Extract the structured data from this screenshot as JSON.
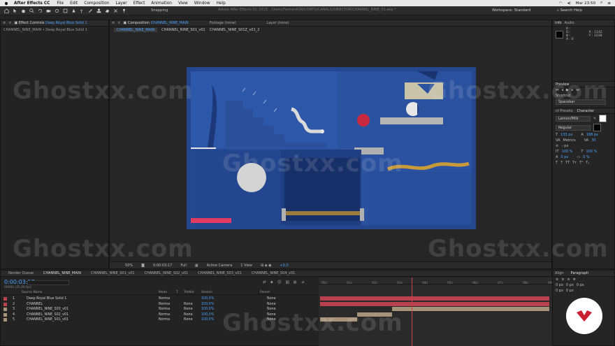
{
  "menubar": {
    "app_name": "After Effects CC",
    "items": [
      "File",
      "Edit",
      "Composition",
      "Layer",
      "Effect",
      "Animation",
      "View",
      "Window",
      "Help"
    ],
    "clock": "Mar 23:50"
  },
  "toolbar": {
    "snapping_label": "Snapping",
    "window_title": "Adobe After Effects CC 2015 - /Users/FermentOR/CONTO/CANALS/DIRECTOR/CHANNEL_NINE_01.aep *",
    "workspace_label": "Workspace:",
    "workspace_value": "Standard",
    "search_label": "Search Help"
  },
  "effect_panel": {
    "tab_prefix": "Effect Controls",
    "tab_layer": "Deep Royal Blue Solid 1",
    "breadcrumb": "CHANNEL_NINE_MAIN • Deep Royal Blue Solid 1"
  },
  "comp_panel": {
    "tab_prefix": "Composition",
    "tab_comp": "CHANNEL_NINE_MAIN",
    "footage_tab": "Footage (none)",
    "layer_tab": "Layer (none)",
    "subtabs": [
      "CHANNEL_NINE_MAIN",
      "CHANNEL_NINE_S01_v01",
      "CHANNEL_NINE_S01Z_v01_2"
    ],
    "footer": {
      "zoom": "50%",
      "timecode": "0:00:03:17",
      "resolution": "Full",
      "camera": "Active Camera",
      "view": "1 View",
      "exposure": "+0,0"
    }
  },
  "right_panel": {
    "info_tabs": [
      "Info",
      "Audio"
    ],
    "x_label": "X : 1142",
    "y_label": "Y : 1238",
    "rgba": [
      "R :",
      "G :",
      "B :",
      "A : 0"
    ],
    "preview_label": "Preview",
    "shortcut_label": "Shortcut",
    "shortcut_value": "Spacebar",
    "presets_label": "ct Presets",
    "character_label": "Character",
    "font_name": "Lemon/Milk",
    "font_style": "Regular",
    "font_size": "133 px",
    "leading": "188 px",
    "metrics": "Metrics",
    "tracking": "30",
    "dash_px": "– px",
    "scale_v": "100 %",
    "scale_h": "100 %",
    "baseline": "0 px",
    "tsume": "0 %"
  },
  "timeline": {
    "tabs": [
      "Render Queue",
      "CHANNEL_NINE_MAIN",
      "CHANNEL_NINE_S01_v01",
      "CHANNEL_NINE_S02_v01",
      "CHANNEL_NINE_S03_v01",
      "CHANNEL_NINE_S04_v01"
    ],
    "timecode": "0:00:03:17",
    "frame_info": "00092 (25.00 fps)",
    "columns": [
      "Source Name",
      "Mode",
      "T",
      "TrkMat",
      "Stretch",
      "Parent"
    ],
    "layers": [
      {
        "num": "1",
        "name": "Deep Royal Blue Solid 1",
        "mode": "Norma",
        "trk": "",
        "pct": "100,0%",
        "parent": "None",
        "color": "#b9424e"
      },
      {
        "num": "2",
        "name": "CHANNEL",
        "mode": "Norma",
        "trk": "None",
        "pct": "100,0%",
        "parent": "None",
        "color": "#b9424e"
      },
      {
        "num": "3",
        "name": "CHANNEL_NINE_S03_v01",
        "mode": "Norma",
        "trk": "None",
        "pct": "100,0%",
        "parent": "None",
        "color": "#a89378"
      },
      {
        "num": "4",
        "name": "CHANNEL_NINE_S02_v01",
        "mode": "Norma",
        "trk": "None",
        "pct": "100,0%",
        "parent": "None",
        "color": "#a89378"
      },
      {
        "num": "5",
        "name": "CHANNEL_NINE_S01_v01",
        "mode": "Norma",
        "trk": "None",
        "pct": "100,0%",
        "parent": "None",
        "color": "#a89378"
      }
    ],
    "ruler_labels": [
      "00s",
      "01s",
      "02s",
      "03s",
      "04s",
      "05s",
      "06s",
      "07s",
      "08s",
      "09s"
    ]
  },
  "align_panel": {
    "tabs": [
      "Align",
      "Paragraph"
    ],
    "values": [
      "0 px",
      "0 px",
      "0 px",
      "0 px",
      "0 px"
    ]
  },
  "watermark": "Ghostxx.com"
}
